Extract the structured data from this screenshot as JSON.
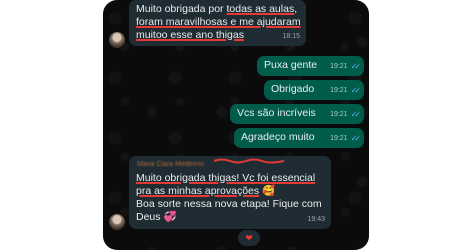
{
  "chat": {
    "messages": [
      {
        "direction": "incoming",
        "lines": [
          "Muito obrigada por todas as aulas,",
          "foram maravilhosas e me ajudaram",
          "muitoo esse ano thigas"
        ],
        "time": "18:15"
      },
      {
        "direction": "outgoing",
        "text": "Puxa gente",
        "time": "19:21"
      },
      {
        "direction": "outgoing",
        "text": "Obrigado",
        "time": "19:21"
      },
      {
        "direction": "outgoing",
        "text": "Vcs são incríveis",
        "time": "19:21"
      },
      {
        "direction": "outgoing",
        "text": "Agradeço muito",
        "time": "19:21"
      },
      {
        "direction": "incoming",
        "sender": "Maria Clara Medeiros",
        "lines": [
          "Muito obrigada thigas! Vc foi essencial",
          "pra as minhas aprovações",
          "Boa sorte nessa nova etapa! Fique com",
          "Deus"
        ],
        "emoji_1": "🥰",
        "emoji_2": "💞",
        "time": "19:43",
        "reaction": "❤"
      }
    ]
  },
  "colors": {
    "background": "#0b0b0b",
    "incoming_bubble": "#202c33",
    "outgoing_bubble": "#005c4b",
    "read_ticks": "#53bdeb",
    "highlight_underline": "#e53935"
  },
  "icons": [
    "avatar",
    "double-check-icon",
    "heart-reaction-icon"
  ]
}
